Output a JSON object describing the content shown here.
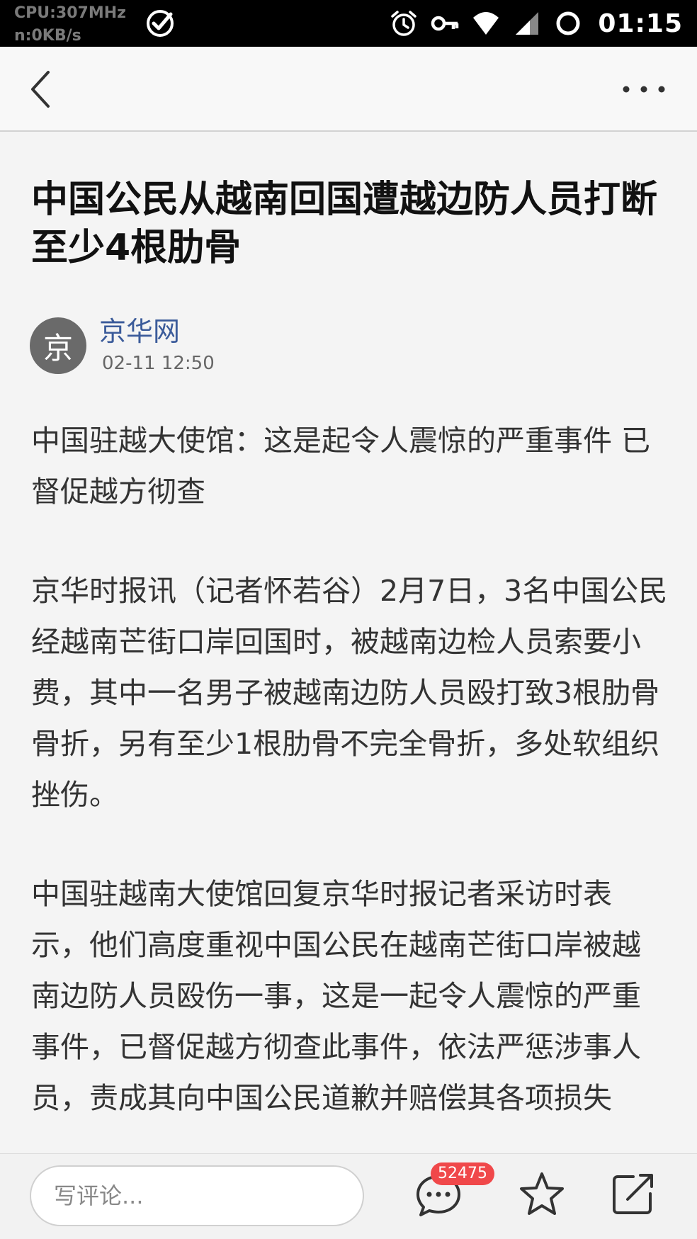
{
  "status_bar": {
    "cpu": "CPU:307MHz",
    "net": "n:0KB/s",
    "time": "01:15",
    "icons": [
      "check-icon",
      "alarm-icon",
      "key-icon",
      "wifi-icon",
      "signal-icon",
      "sync-icon"
    ]
  },
  "nav": {
    "back_icon": "chevron-left-icon",
    "more_icon": "more-horizontal-icon"
  },
  "article": {
    "title": "中国公民从越南回国遭越边防人员打断至少4根肋骨",
    "source": {
      "avatar_char": "京",
      "name": "京华网",
      "time": "02-11 12:50"
    },
    "paragraphs": [
      "中国驻越大使馆：这是起令人震惊的严重事件 已督促越方彻查",
      "京华时报讯（记者怀若谷）2月7日，3名中国公民经越南芒街口岸回国时，被越南边检人员索要小费，其中一名男子被越南边防人员殴打致3根肋骨骨折，另有至少1根肋骨不完全骨折，多处软组织挫伤。",
      "中国驻越南大使馆回复京华时报记者采访时表示，他们高度重视中国公民在越南芒街口岸被越南边防人员殴伤一事，这是一起令人震惊的严重事件，已督促越方彻查此事件，依法严惩涉事人员，责成其向中国公民道歉并赔偿其各项损失"
    ]
  },
  "bottom_bar": {
    "comment_placeholder": "写评论...",
    "comment_count": "52475",
    "icons": [
      "comment-icon",
      "star-icon",
      "share-icon"
    ],
    "badge_color": "#f0484a"
  }
}
